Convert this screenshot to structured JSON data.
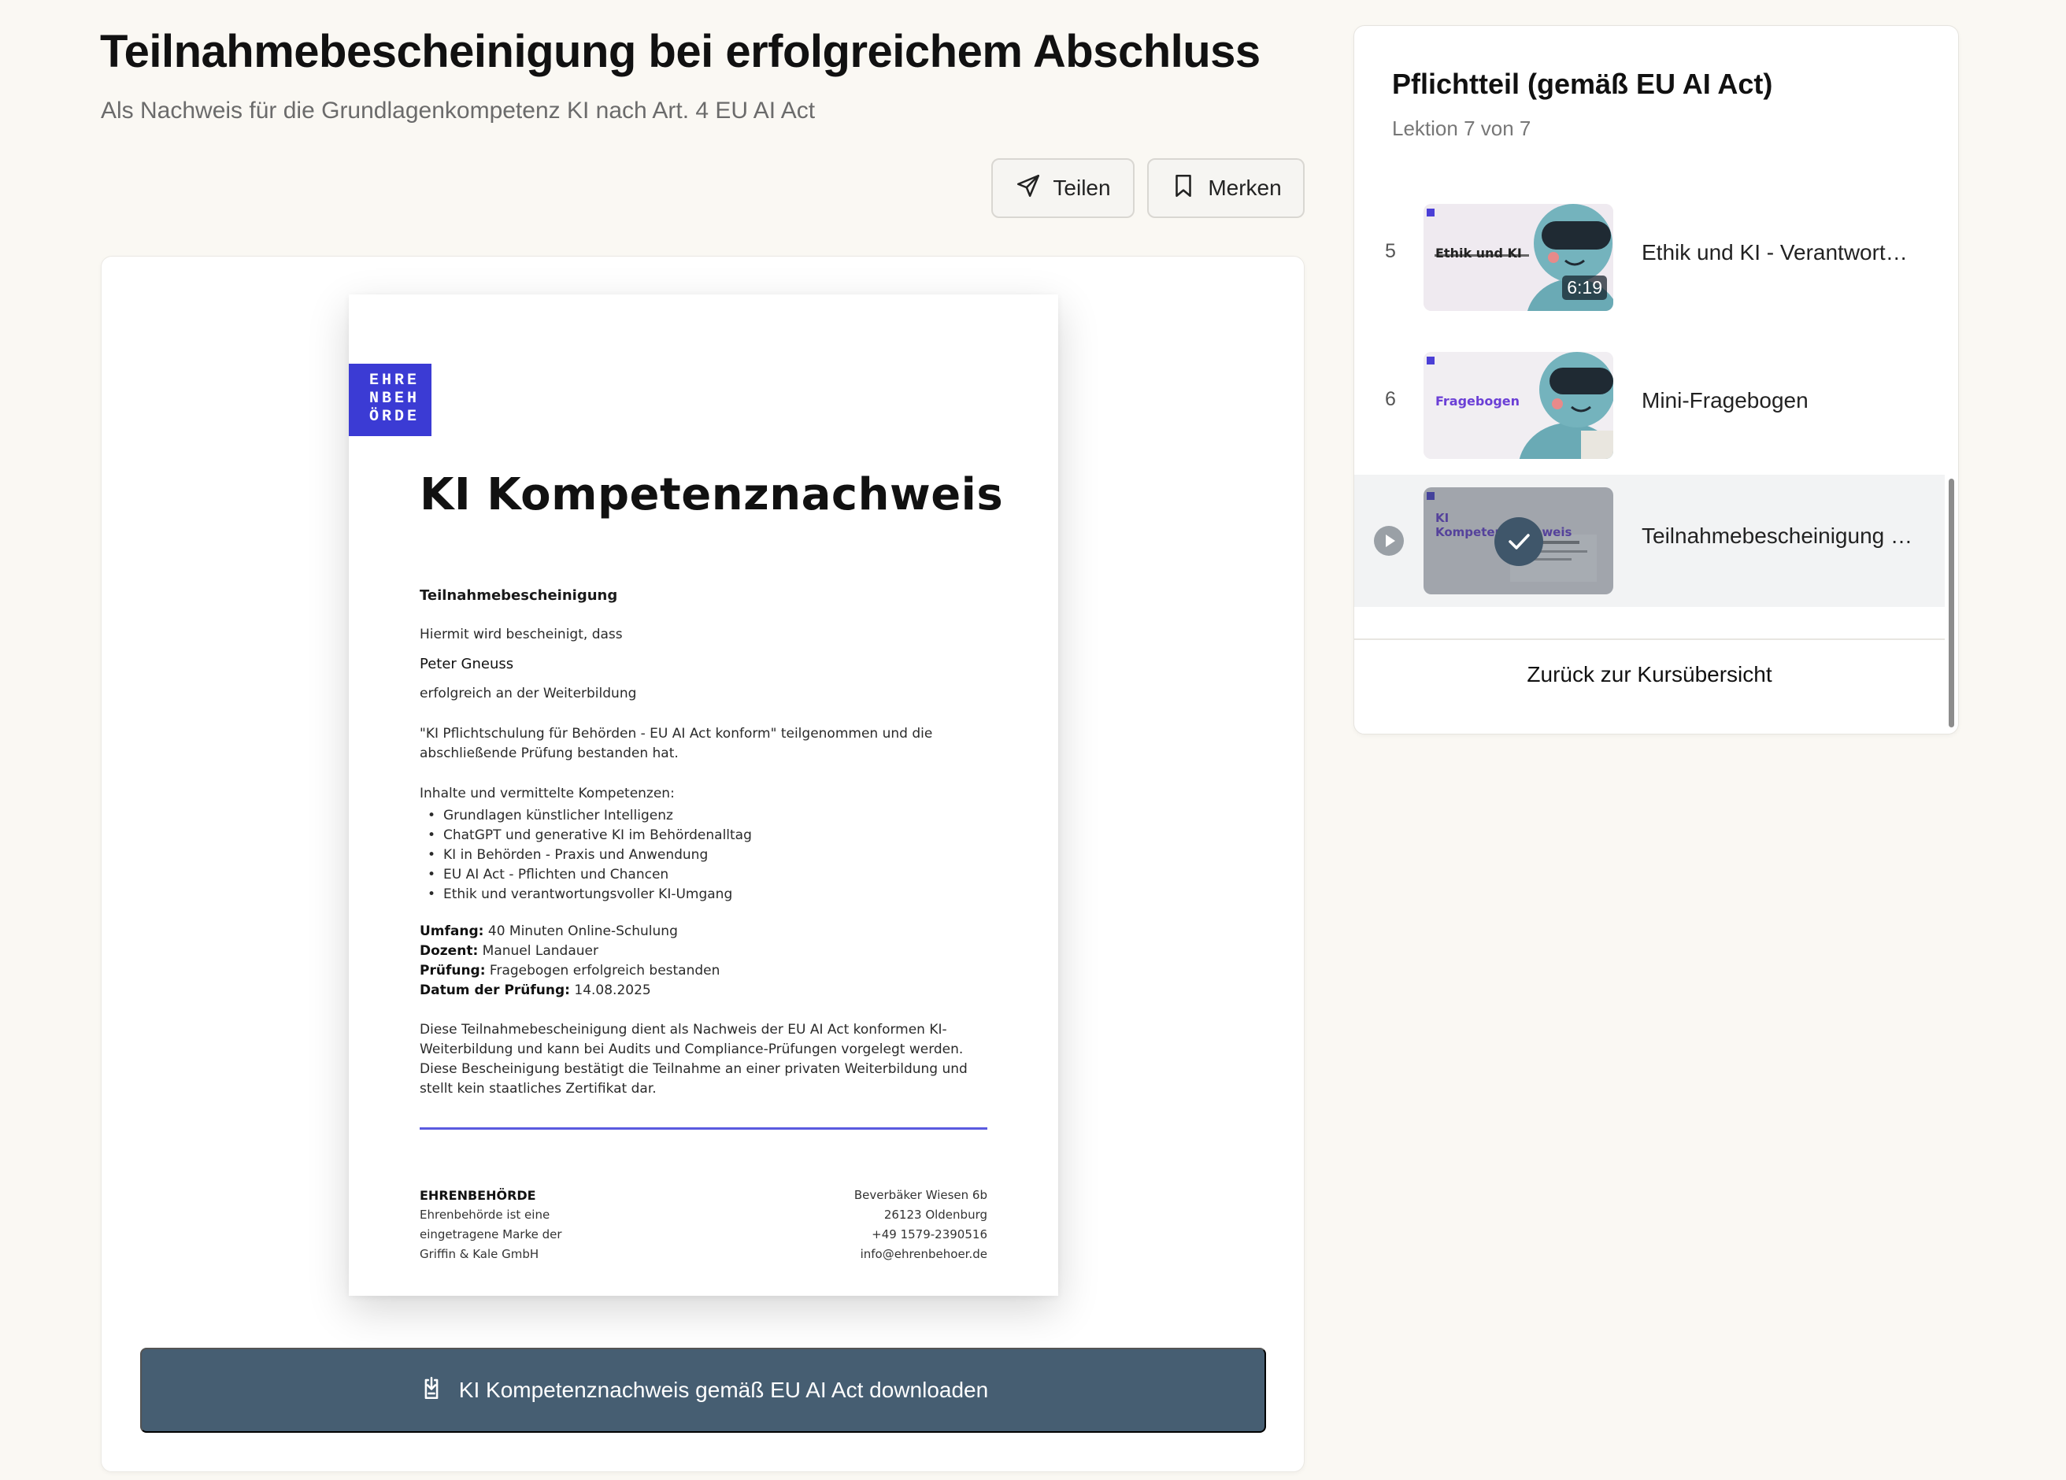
{
  "page": {
    "title": "Teilnahmebescheinigung bei erfolgreichem Abschluss",
    "subtitle": "Als Nachweis für die Grundlagenkompetenz KI nach Art. 4 EU AI Act"
  },
  "actions": {
    "share_label": "Teilen",
    "save_label": "Merken"
  },
  "certificate": {
    "logo_lines": [
      "EHRE",
      "NBEH",
      "ÖRDE"
    ],
    "heading": "KI Kompetenznachweis",
    "subheading": "Teilnahmebescheinigung",
    "intro": "Hiermit wird bescheinigt, dass",
    "name": "Peter Gneuss",
    "line_after_name": "erfolgreich an der Weiterbildung",
    "course_sentence": "\"KI Pflichtschulung für Behörden - EU AI Act konform\" teilgenommen und die abschließende Prüfung bestanden hat.",
    "contents_label": "Inhalte und vermittelte Kompetenzen:",
    "contents": [
      "Grundlagen künstlicher Intelligenz",
      "ChatGPT und generative KI im Behördenalltag",
      "KI in Behörden - Praxis und Anwendung",
      "EU AI Act - Pflichten und Chancen",
      "Ethik und verantwortungsvoller KI-Umgang"
    ],
    "facts": {
      "scope_label": "Umfang:",
      "scope": "40 Minuten Online-Schulung",
      "lecturer_label": "Dozent:",
      "lecturer": "Manuel Landauer",
      "exam_label": "Prüfung:",
      "exam": "Fragebogen erfolgreich bestanden",
      "date_label": "Datum der Prüfung:",
      "date": "14.08.2025"
    },
    "disclaimer": "Diese Teilnahmebescheinigung dient als Nachweis der EU AI Act konformen KI-Weiterbildung und kann bei Audits und Compliance-Prüfungen vorgelegt werden. Diese Bescheinigung bestätigt die Teilnahme an einer privaten Weiterbildung und stellt kein staatliches Zertifikat dar.",
    "footer_left": {
      "brand": "EHRENBEHÖRDE",
      "lines": [
        "Ehrenbehörde ist eine",
        "eingetragene Marke der",
        "Griffin & Kale GmbH"
      ]
    },
    "footer_right": [
      "Beverbäker Wiesen 6b",
      "26123 Oldenburg",
      "+49 1579-2390516",
      "info@ehrenbehoer.de"
    ]
  },
  "download": {
    "label": "KI Kompetenznachweis gemäß EU AI Act downloaden"
  },
  "sidebar": {
    "title": "Pflichtteil (gemäß EU AI Act)",
    "progress": "Lektion 7 von 7",
    "lessons": [
      {
        "number": "5",
        "title": "Ethik und KI - Verantwortu…",
        "thumb_text": "Ethik und KI",
        "duration": "6:19"
      },
      {
        "number": "6",
        "title": "Mini-Fragebogen",
        "thumb_text": "Fragebogen"
      },
      {
        "number": "7",
        "title": "Teilnahmebescheinigung b…",
        "thumb_text": "KI Kompetenznachweis",
        "active": true
      }
    ],
    "back_label": "Zurück zur Kursübersicht"
  },
  "colors": {
    "background": "#faf8f3",
    "download_button": "#465e72",
    "logo_blue": "#3b3bd4",
    "active_lesson": "#f2f3f4"
  },
  "icons": [
    "send-icon",
    "bookmark-icon",
    "download-icon",
    "play-icon",
    "checkmark-icon"
  ]
}
